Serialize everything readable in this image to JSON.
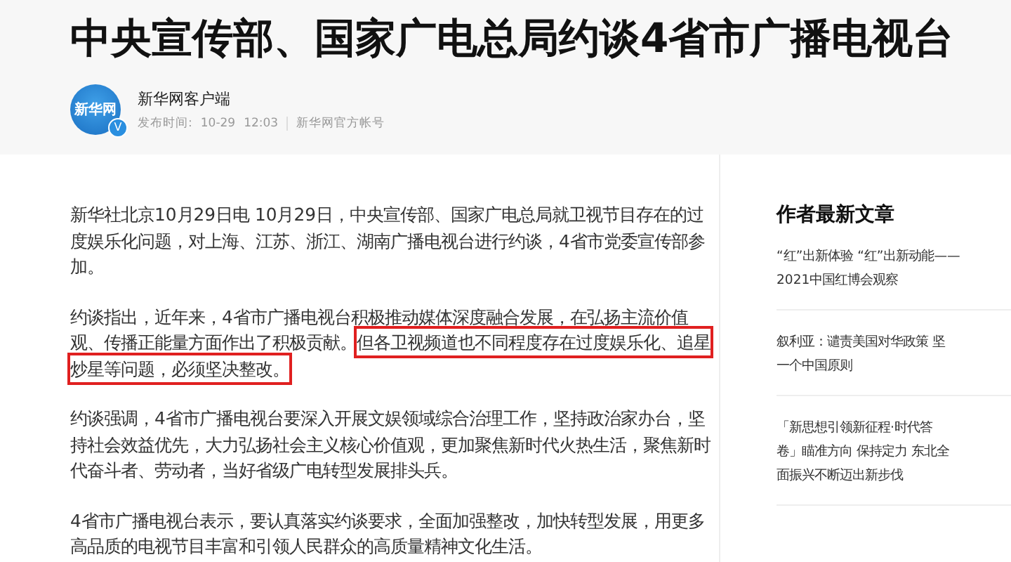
{
  "headline": "中央宣传部、国家广电总局约谈4省市广播电视台",
  "author": {
    "logo_text": "新华网",
    "verified_mark": "V",
    "name": "新华网客户端",
    "published_label": "发布时间:",
    "date": "10-29",
    "time": "12:03",
    "account_type": "新华网官方帐号"
  },
  "paragraphs": [
    {
      "segments": [
        {
          "text": "新华社北京10月29日电 10月29日，中央宣传部、国家广电总局就卫视节目存在的过度娱乐化问题，对上海、江苏、浙江、湖南广播电视台进行约谈，4省市党委宣传部参加。",
          "highlighted": false
        }
      ]
    },
    {
      "segments": [
        {
          "text": "约谈指出，近年来，4省市广播电视台积极推动媒体深度融合发展，在弘扬主流价值观、传播正能量方面作出了积极贡献。",
          "highlighted": false
        },
        {
          "text": "但各卫视频道也不同程度存在过度娱乐化、追星炒星等问题，必须坚决整改。",
          "highlighted": true
        }
      ]
    },
    {
      "segments": [
        {
          "text": "约谈强调，4省市广播电视台要深入开展文娱领域综合治理工作，坚持政治家办台，坚持社会效益优先，大力弘扬社会主义核心价值观，更加聚焦新时代火热生活，聚焦新时代奋斗者、劳动者，当好省级广电转型发展排头兵。",
          "highlighted": false
        }
      ]
    },
    {
      "segments": [
        {
          "text": "4省市广播电视台表示，要认真落实约谈要求，全面加强整改，加快转型发展，用更多高品质的电视节目丰富和引领人民群众的高质量精神文化生活。",
          "highlighted": false
        }
      ]
    }
  ],
  "sidebar": {
    "heading": "作者最新文章",
    "articles": [
      {
        "title_lines": [
          "“红”出新体验 “红”出新动能——",
          "2021中国红博会观察"
        ]
      },
      {
        "title_lines": [
          "叙利亚：谴责美国对华政策 坚",
          "一个中国原则"
        ]
      },
      {
        "title_lines": [
          "「新思想引领新征程·时代答",
          "卷」瞄准方向 保持定力 东北全",
          "面振兴不断迈出新步伐"
        ]
      }
    ]
  }
}
